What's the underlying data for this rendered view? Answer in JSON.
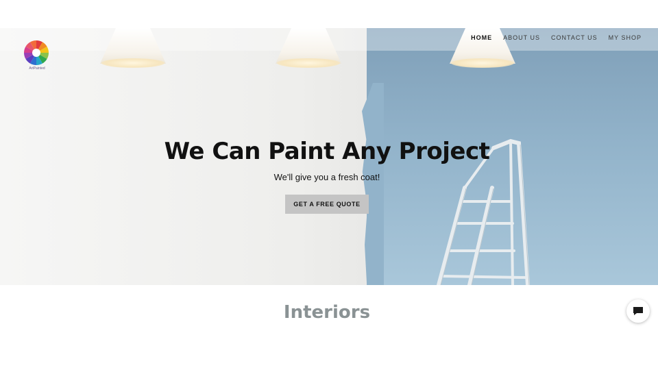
{
  "header": {
    "logo_text": "ArtPainted",
    "nav": [
      {
        "label": "HOME",
        "active": true
      },
      {
        "label": "ABOUT US",
        "active": false
      },
      {
        "label": "CONTACT US",
        "active": false
      },
      {
        "label": "MY SHOP",
        "active": false
      }
    ]
  },
  "hero": {
    "title": "We Can Paint Any Project",
    "subtitle": "We'll give you a fresh coat!",
    "cta_label": "GET A FREE QUOTE"
  },
  "section": {
    "title": "Interiors"
  },
  "chat": {
    "icon": "chat-icon"
  },
  "colors": {
    "accent_blue_wall": "#92b3ca",
    "cta_background": "#c4c4c4",
    "section_title": "#8a9294"
  }
}
